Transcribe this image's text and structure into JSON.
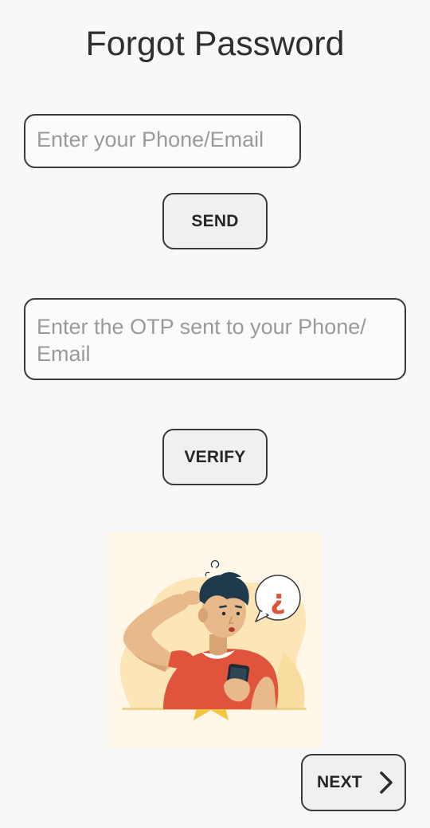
{
  "header": {
    "title": "Forgot Password"
  },
  "form": {
    "phone_email": {
      "placeholder": "Enter your Phone/Email",
      "value": ""
    },
    "send_label": "SEND",
    "otp": {
      "placeholder": "Enter the OTP sent to your Phone/ Email",
      "value": ""
    },
    "verify_label": "VERIFY"
  },
  "illustration": {
    "icon": "confused-person-with-phone-illustration",
    "speech_bubble_text": "¿"
  },
  "footer": {
    "next_label": "NEXT",
    "next_icon": "chevron-right-icon"
  },
  "colors": {
    "background": "#f8f8f8",
    "border": "#3a3a3a",
    "placeholder": "#9a9a9a",
    "button_fill": "#f0f0f0",
    "illustration_bg": "#fff8ea",
    "accent_orange": "#e0533c",
    "blob": "#fce6b8"
  }
}
